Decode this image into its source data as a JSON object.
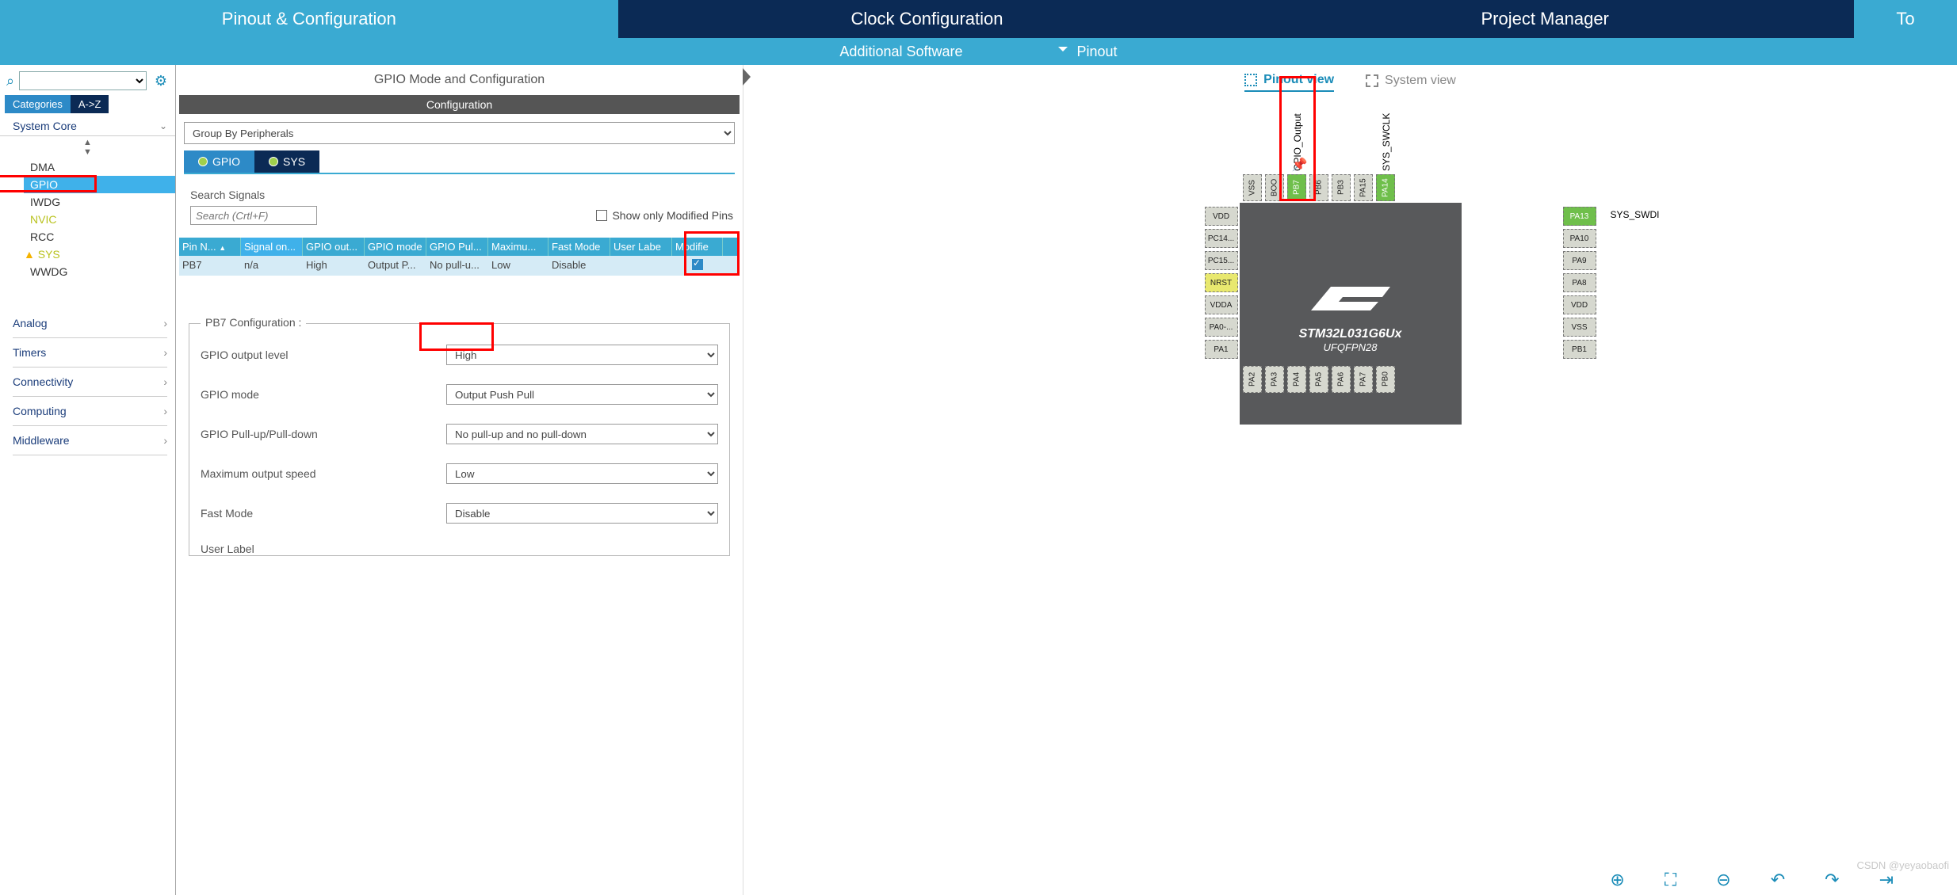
{
  "top_tabs": {
    "pinout": "Pinout & Configuration",
    "clock": "Clock Configuration",
    "project": "Project Manager",
    "tools": "To"
  },
  "subbar": {
    "additional": "Additional Software",
    "pinout": "Pinout"
  },
  "sidebar": {
    "cat_tab": "Categories",
    "az_tab": "A->Z",
    "system_core": "System Core",
    "items": [
      "DMA",
      "GPIO",
      "IWDG",
      "NVIC",
      "RCC",
      "SYS",
      "WWDG"
    ],
    "sections": [
      "Analog",
      "Timers",
      "Connectivity",
      "Computing",
      "Middleware"
    ]
  },
  "config": {
    "title": "GPIO Mode and Configuration",
    "header": "Configuration",
    "group_by": "Group By Peripherals",
    "sub_tabs": {
      "gpio": "GPIO",
      "sys": "SYS"
    },
    "search_label": "Search Signals",
    "search_placeholder": "Search (Crtl+F)",
    "show_modified": "Show only Modified Pins",
    "thead": [
      "Pin N...",
      "Signal on...",
      "GPIO out...",
      "GPIO mode",
      "GPIO Pul...",
      "Maximu...",
      "Fast Mode",
      "User Labe",
      "Modifie"
    ],
    "row": {
      "pin": "PB7",
      "signal": "n/a",
      "out": "High",
      "mode": "Output P...",
      "pull": "No pull-u...",
      "max": "Low",
      "fast": "Disable",
      "label": ""
    },
    "fieldset_title": "PB7 Configuration :",
    "fields": {
      "out_level": {
        "label": "GPIO output level",
        "value": "High"
      },
      "mode": {
        "label": "GPIO mode",
        "value": "Output Push Pull"
      },
      "pull": {
        "label": "GPIO Pull-up/Pull-down",
        "value": "No pull-up and no pull-down"
      },
      "speed": {
        "label": "Maximum output speed",
        "value": "Low"
      },
      "fast": {
        "label": "Fast Mode",
        "value": "Disable"
      },
      "user_label": {
        "label": "User Label",
        "value": ""
      }
    }
  },
  "viewer": {
    "pinout_tab": "Pinout view",
    "system_tab": "System view",
    "chip_model": "STM32L031G6Ux",
    "chip_package": "UFQFPN28",
    "pb7_label": "GPIO_Output",
    "swclk_label": "SYS_SWCLK",
    "swdio_label": "SYS_SWDI",
    "pins_left": [
      "VDD",
      "PC14...",
      "PC15...",
      "NRST",
      "VDDA",
      "PA0-...",
      "PA1"
    ],
    "pins_right": [
      "PA13",
      "PA10",
      "PA9",
      "PA8",
      "VDD",
      "VSS",
      "PB1"
    ],
    "pins_bottom": [
      "PA2",
      "PA3",
      "PA4",
      "PA5",
      "PA6",
      "PA7",
      "PB0"
    ],
    "pins_top_left": [
      "VSS",
      "BOO"
    ],
    "pins_top_mid": [
      "PB7",
      "PB6"
    ],
    "pins_top_right": [
      "PB3",
      "PA15",
      "PA14"
    ]
  },
  "watermark": "CSDN @yeyaobaofi"
}
